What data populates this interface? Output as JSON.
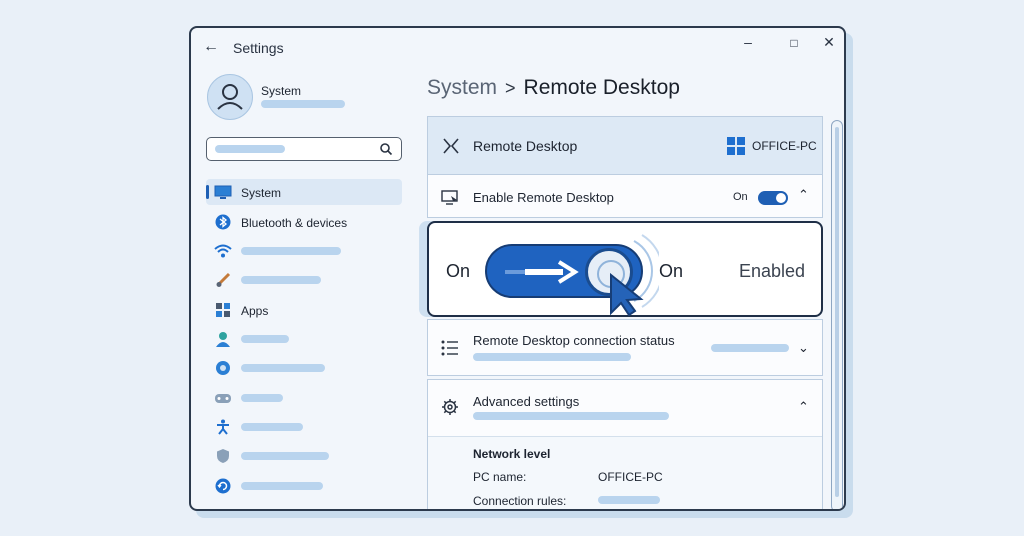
{
  "window": {
    "title": "Settings"
  },
  "user": {
    "name": "System"
  },
  "search": {
    "placeholder": ""
  },
  "sidebar": {
    "items": [
      {
        "label": "System",
        "icon": "monitor-icon",
        "selected": true
      },
      {
        "label": "Bluetooth & devices",
        "icon": "bluetooth-icon"
      },
      {
        "label": "",
        "icon": "wifi-icon"
      },
      {
        "label": "",
        "icon": "brush-icon"
      },
      {
        "label": "Apps",
        "icon": "apps-icon"
      },
      {
        "label": "",
        "icon": "person-icon"
      },
      {
        "label": "",
        "icon": "globe-icon"
      },
      {
        "label": "",
        "icon": "gamepad-icon"
      },
      {
        "label": "",
        "icon": "accessibility-icon"
      },
      {
        "label": "",
        "icon": "shield-icon"
      },
      {
        "label": "",
        "icon": "update-icon"
      }
    ]
  },
  "breadcrumb": {
    "parent": "System",
    "separator": ">",
    "current": "Remote Desktop"
  },
  "header_card": {
    "title": "Remote Desktop",
    "pc_name": "OFFICE-PC"
  },
  "enable_row": {
    "label": "Enable Remote Desktop",
    "state": "On"
  },
  "callout": {
    "left_label": "On",
    "right_label": "On",
    "status": "Enabled"
  },
  "status_row": {
    "label": "Remote Desktop connection status"
  },
  "advanced": {
    "title": "Advanced settings",
    "network_level": "Network level",
    "pc_name_label": "PC name:",
    "pc_name_value": "OFFICE-PC",
    "connection_rules_label": "Connection rules:"
  },
  "colors": {
    "accent": "#1e5fb4",
    "background": "#e9f0f8"
  }
}
